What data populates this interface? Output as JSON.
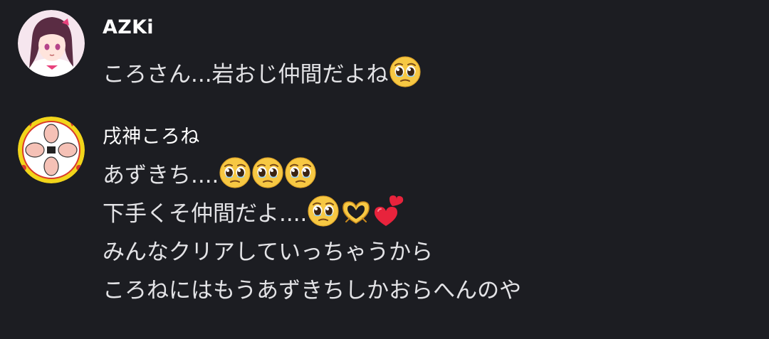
{
  "comments": [
    {
      "author": "AZKi",
      "avatar_icon": "anime-girl-avatar-icon",
      "lines": [
        {
          "text": "ころさん...岩おじ仲間だよね",
          "emojis": [
            "pleading-face-icon"
          ]
        }
      ]
    },
    {
      "author": "戌神ころね",
      "avatar_icon": "hands-emblem-avatar-icon",
      "lines": [
        {
          "text": "あずきち....",
          "emojis": [
            "pleading-face-icon",
            "pleading-face-icon",
            "pleading-face-icon"
          ]
        },
        {
          "text": "下手くそ仲間だよ....",
          "emojis": [
            "pleading-face-icon",
            "heart-hands-icon",
            "two-hearts-icon"
          ]
        },
        {
          "text": "みんなクリアしていっちゃうから",
          "emojis": []
        },
        {
          "text": "ころねにはもうあずきちしかおらへんのや",
          "emojis": []
        }
      ]
    }
  ],
  "colors": {
    "background": "#1c1d22",
    "author_text": "#ffffff",
    "comment_text": "#e3e3e6"
  }
}
